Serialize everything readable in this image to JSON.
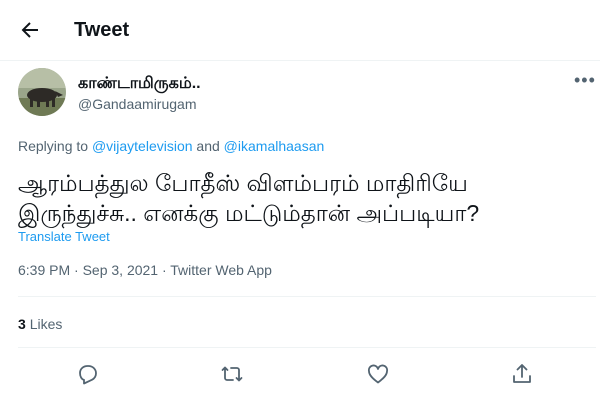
{
  "header": {
    "title": "Tweet",
    "back_icon": "back-arrow-icon"
  },
  "tweet": {
    "author_name": "காண்டாமிருகம்..",
    "author_handle": "@Gandaamirugam",
    "replying_prefix": "Replying to",
    "replying_user1": "@vijaytelevision",
    "replying_and": "and",
    "replying_user2": "@ikamalhaasan",
    "text_line1": "ஆரம்பத்துல போதீஸ் விளம்பரம் மாதிரியே",
    "text_line2": "இருந்துச்சு.. எனக்கு மட்டும்தான் அப்படியா?",
    "translate": "Translate Tweet",
    "timestamp": "6:39 PM · Sep 3, 2021 · Twitter Web App",
    "likes_count": "3",
    "likes_label": "Likes"
  },
  "actions": [
    "reply-icon",
    "retweet-icon",
    "like-icon",
    "share-icon"
  ],
  "colors": {
    "accent": "#1d9bf0",
    "text": "#0f1419",
    "muted": "#536471",
    "border": "#eff3f4"
  }
}
